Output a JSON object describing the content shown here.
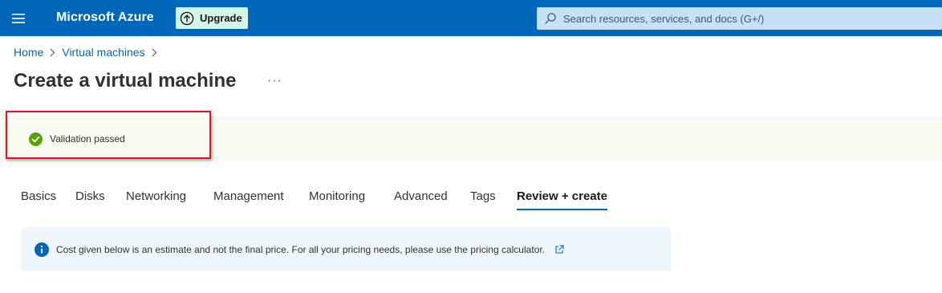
{
  "topbar": {
    "menu_icon": "hamburger-menu-icon",
    "brand": "Microsoft Azure",
    "upgrade_label": "Upgrade",
    "upgrade_icon": "arrow-up-circle-icon",
    "search_placeholder": "Search resources, services, and docs (G+/)",
    "search_icon": "search-icon",
    "colors": {
      "bar": "#0067b8",
      "upgrade_bg": "#d5f5e8",
      "search_bg": "#c7e0f4"
    }
  },
  "breadcrumb": {
    "items": [
      "Home",
      "Virtual machines"
    ]
  },
  "page": {
    "title": "Create a virtual machine",
    "more_label": "···"
  },
  "validation": {
    "message": "Validation passed",
    "icon": "check-circle-icon",
    "color": "#57a300"
  },
  "tabs": [
    {
      "label": "Basics"
    },
    {
      "label": "Disks"
    },
    {
      "label": "Networking"
    },
    {
      "label": "Management"
    },
    {
      "label": "Monitoring"
    },
    {
      "label": "Advanced"
    },
    {
      "label": "Tags"
    },
    {
      "label": "Review + create",
      "active": true
    }
  ],
  "info": {
    "text": "Cost given below is an estimate and not the final price. For all your pricing needs, please use the pricing calculator.",
    "icon": "info-icon",
    "link_icon": "external-link-icon"
  }
}
